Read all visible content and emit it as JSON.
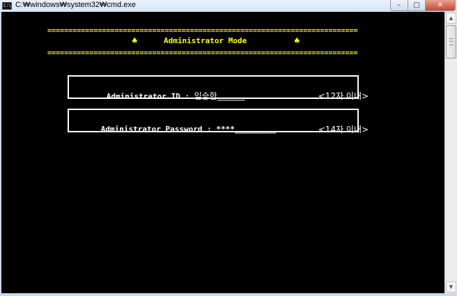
{
  "window": {
    "title": "C:₩windows₩system32₩cmd.exe",
    "icon_label": "C:\\",
    "controls": {
      "minimize": "–",
      "maximize": "□",
      "close": "✕"
    }
  },
  "console": {
    "rule_top": "==========================================================================",
    "rule_bottom": "==========================================================================",
    "heading": {
      "spade": "♠",
      "title": "Administrator Mode"
    },
    "id_field": {
      "label": "Administrator ID : ",
      "value": "임승한",
      "underline": "______",
      "hint": "<12자 이내>"
    },
    "password_field": {
      "label": "Administrator Password : ",
      "value": "****",
      "underline": "_________",
      "hint": "<14자 이내>"
    },
    "colors": {
      "background": "#000000",
      "heading": "#ffff00",
      "text": "#ffffff"
    }
  },
  "scrollbar": {
    "up_icon": "▲",
    "down_icon": "▼"
  }
}
